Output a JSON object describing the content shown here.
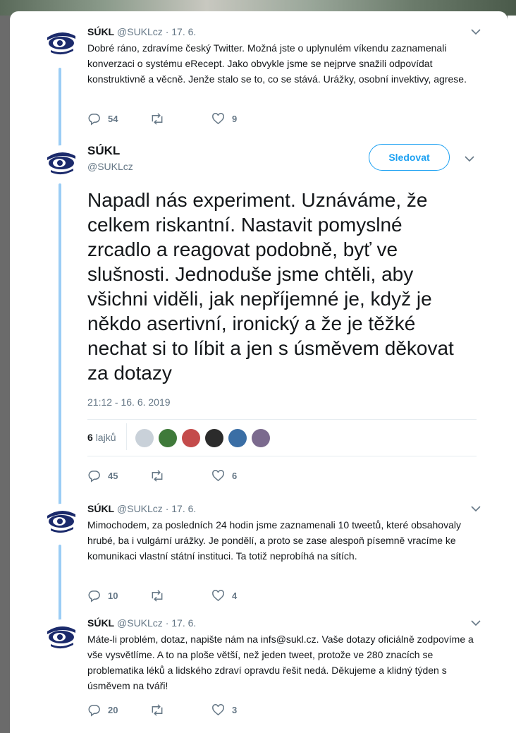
{
  "account": {
    "name": "SÚKL",
    "handle": "@SUKLcz"
  },
  "tweets": [
    {
      "date": "17. 6.",
      "text": "Dobré ráno, zdravíme český Twitter. Možná jste o uplynulém víkendu zaznamenali konverzaci o systému eRecept. Jako obvykle jsme se nejprve snažili odpovídat konstruktivně a věcně. Jenže stalo se to, co se stává. Urážky, osobní invektivy, agrese.",
      "replies": "54",
      "retweets": "",
      "likes": "9"
    },
    {
      "date": "17. 6.",
      "text": "Mimochodem, za posledních 24 hodin jsme zaznamenali 10 tweetů, které obsahovaly hrubé, ba i vulgární urážky. Je pondělí, a proto se zase alespoň písemně vracíme ke komunikaci vlastní státní instituci. Ta totiž neprobíhá na sítích.",
      "replies": "10",
      "retweets": "",
      "likes": "4"
    },
    {
      "date": "17. 6.",
      "text": "Máte-li problém, dotaz, napište nám na infs@sukl.cz. Vaše dotazy oficiálně zodpovíme a vše vysvětlíme. A to na ploše větší, než jeden tweet, protože ve 280 znacích se problematika léků a lidského zdraví opravdu řešit nedá. Děkujeme a klidný týden s úsměvem na tváři!",
      "replies": "20",
      "retweets": "",
      "likes": "3"
    }
  ],
  "main_tweet": {
    "follow_label": "Sledovat",
    "text": "Napadl nás experiment. Uznáváme, že celkem riskantní. Nastavit pomyslné zrcadlo a reagovat podobně, byť ve slušnosti. Jednoduše jsme chtěli, aby všichni viděli, jak nepříjemné je, když je někdo asertivní, ironický a že je těžké nechat si to líbit a jen s úsměvem děkovat za dotazy",
    "timestamp": "21:12 - 16. 6. 2019",
    "likes_count": "6",
    "likes_label": "lajků",
    "replies": "45",
    "retweets": "",
    "likes": "6",
    "liker_colors": [
      "#c9d1d9",
      "#3f7a3a",
      "#c44b4b",
      "#2b2b2b",
      "#3a6ea5",
      "#7b6a8e"
    ]
  },
  "colors": {
    "accent": "#1da1f2",
    "thread_line": "#9bcdf5",
    "muted": "#657786"
  }
}
